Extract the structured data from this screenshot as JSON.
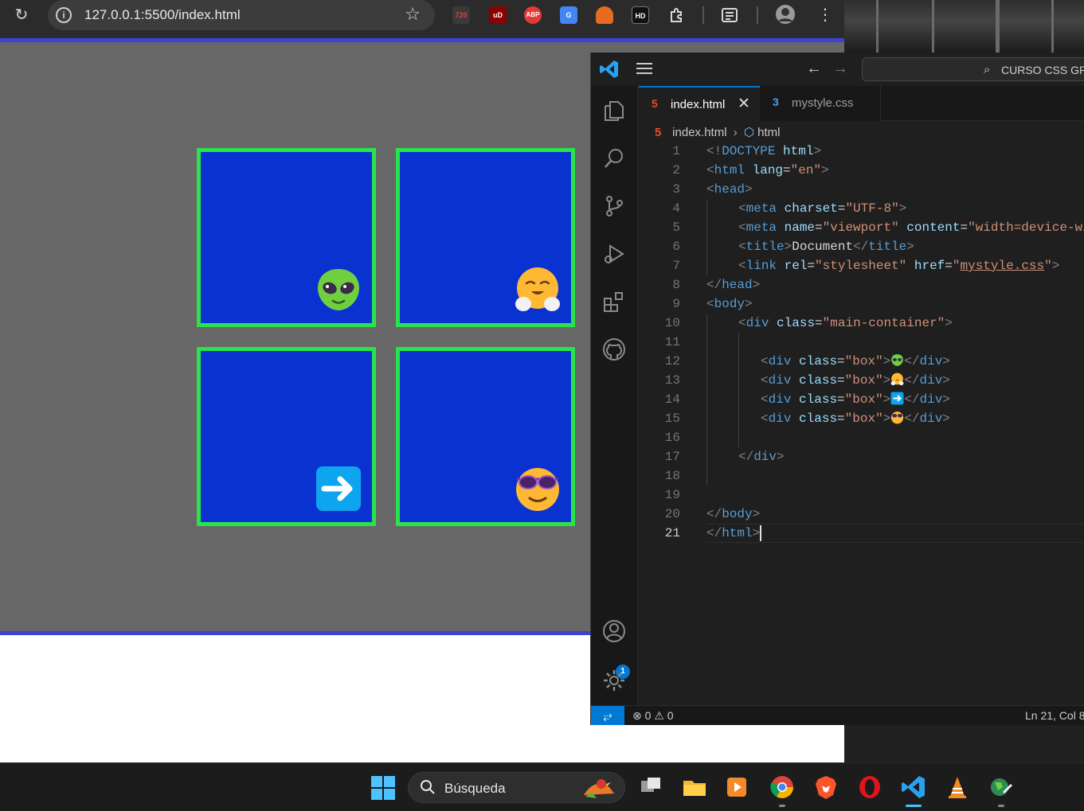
{
  "browser": {
    "url": "127.0.0.1:5500/index.html",
    "extensions": [
      {
        "name": "720-extension-icon",
        "label": "720",
        "color": "#3a3a3a",
        "text_color": "#e04040"
      },
      {
        "name": "ublock-icon",
        "label": "uD",
        "color": "#8b0000"
      },
      {
        "name": "adblock-plus-icon",
        "label": "ABP",
        "color": "#e53935"
      },
      {
        "name": "google-translate-icon",
        "label": "G",
        "color": "#4285f4"
      },
      {
        "name": "fox-extension-icon",
        "label": "",
        "color": "#e66a1f"
      },
      {
        "name": "hd-extension-icon",
        "label": "HD",
        "color": "#111111"
      }
    ]
  },
  "page": {
    "boxes": [
      {
        "emoji": "alien-emoji"
      },
      {
        "emoji": "smiling-face-with-open-hands-emoji"
      },
      {
        "emoji": "right-arrow-emoji"
      },
      {
        "emoji": "sunglasses-face-emoji"
      }
    ],
    "colors": {
      "box_bg": "#0a32d1",
      "box_border": "#29e34a",
      "viewport_bg": "#676767"
    }
  },
  "vscode": {
    "command_center": "CURSO CSS GRI",
    "tabs": [
      {
        "label": "index.html",
        "icon": "html-file-icon",
        "active": true
      },
      {
        "label": "mystyle.css",
        "icon": "css-file-icon",
        "active": false
      }
    ],
    "breadcrumb": {
      "file": "index.html",
      "symbol": "html"
    },
    "line_numbers": [
      "1",
      "2",
      "3",
      "4",
      "5",
      "6",
      "7",
      "8",
      "9",
      "10",
      "11",
      "12",
      "13",
      "14",
      "15",
      "16",
      "17",
      "18",
      "19",
      "20",
      "21"
    ],
    "code": {
      "doctype_open": "<!",
      "doctype_kw": "DOCTYPE",
      "doctype_val": "html",
      "html_tag": "html",
      "lang_attr": "lang",
      "lang_val": "\"en\"",
      "head_tag": "head",
      "meta_tag": "meta",
      "charset_attr": "charset",
      "charset_val": "\"UTF-8\"",
      "name_attr": "name",
      "name_val": "\"viewport\"",
      "content_attr": "content",
      "content_val": "\"width=device-wi",
      "title_tag": "title",
      "title_text": "Document",
      "link_tag": "link",
      "rel_attr": "rel",
      "rel_val": "\"stylesheet\"",
      "href_attr": "href",
      "href_q": "\"",
      "href_val": "mystyle.css",
      "body_tag": "body",
      "div_tag": "div",
      "class_attr": "class",
      "main_class_val": "\"main-container\"",
      "box_class_val": "\"box\""
    },
    "status": {
      "errors": "0",
      "warnings": "0",
      "cursor": "Ln 21, Col 8"
    },
    "accounts_badge": "1"
  },
  "taskbar": {
    "search_label": "Búsqueda",
    "apps": [
      "task-view-icon",
      "file-explorer-icon",
      "media-player-icon",
      "chrome-icon",
      "brave-icon",
      "opera-icon",
      "vscode-icon",
      "vlc-icon",
      "network-globe-icon"
    ]
  }
}
